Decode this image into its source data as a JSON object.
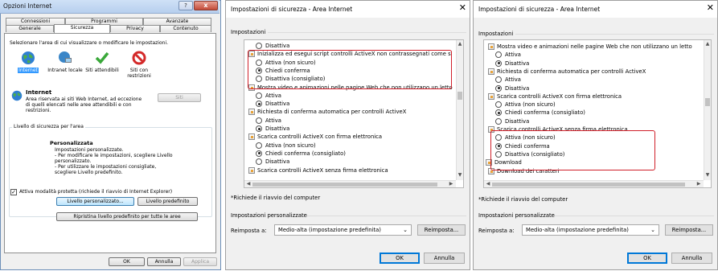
{
  "dialog1": {
    "title": "Opzioni Internet",
    "help_label": "?",
    "close_label": "x",
    "tabs_row1": [
      "Connessioni",
      "Programmi",
      "Avanzate"
    ],
    "tabs_row2": [
      "Generale",
      "Sicurezza",
      "Privacy",
      "Contenuto"
    ],
    "selected_tab": "Sicurezza",
    "select_zone_text": "Selezionare l'area di cui visualizzare o modificare le impostazioni.",
    "zones": [
      {
        "label": "Internet",
        "icon": "globe-icon",
        "selected": true
      },
      {
        "label": "Intranet locale",
        "icon": "intranet-icon",
        "selected": false
      },
      {
        "label": "Siti attendibili",
        "icon": "checkmark-icon",
        "selected": false
      },
      {
        "label": "Siti con restrizioni",
        "icon": "forbidden-icon",
        "selected": false
      }
    ],
    "zone_title": "Internet",
    "zone_desc": "Area riservata ai siti Web Internet, ad eccezione di quelli elencati nelle aree attendibili e con restrizioni.",
    "siti_button": "Siti",
    "level_group_label": "Livello di sicurezza per l'area",
    "custom_title": "Personalizzata",
    "custom_lines": [
      "Impostazioni personalizzate.",
      "- Per modificare le impostazioni, scegliere Livello personalizzato.",
      "- Per utilizzare le impostazioni consigliate, scegliere Livello predefinito."
    ],
    "protected_mode_label": "Attiva modalità protetta (richiede il riavvio di Internet Explorer)",
    "protected_mode_checked": true,
    "custom_level_button": "Livello personalizzato...",
    "default_level_button": "Livello predefinito",
    "reset_all_button": "Ripristina livello predefinito per tutte le aree",
    "ok_button": "OK",
    "cancel_button": "Annulla",
    "apply_button": "Applica"
  },
  "dialog2": {
    "title": "Impostazioni di sicurezza - Area Internet",
    "close_label": "✕",
    "settings_label": "Impostazioni",
    "items": [
      {
        "type": "radio",
        "label": "Disattiva",
        "checked": false
      },
      {
        "type": "setting",
        "label": "Inizializza ed esegui script controlli ActiveX non contrassegnati come si"
      },
      {
        "type": "radio",
        "label": "Attiva (non sicuro)",
        "checked": false
      },
      {
        "type": "radio",
        "label": "Chiedi conferma",
        "checked": true
      },
      {
        "type": "radio",
        "label": "Disattiva (consigliato)",
        "checked": false
      },
      {
        "type": "setting",
        "label": "Mostra video e animazioni nelle pagine Web che non utilizzano un letto"
      },
      {
        "type": "radio",
        "label": "Attiva",
        "checked": false
      },
      {
        "type": "radio",
        "label": "Disattiva",
        "checked": true
      },
      {
        "type": "setting",
        "label": "Richiesta di conferma automatica per controlli ActiveX"
      },
      {
        "type": "radio",
        "label": "Attiva",
        "checked": false
      },
      {
        "type": "radio",
        "label": "Disattiva",
        "checked": true
      },
      {
        "type": "setting",
        "label": "Scarica controlli ActiveX con firma elettronica"
      },
      {
        "type": "radio",
        "label": "Attiva (non sicuro)",
        "checked": false
      },
      {
        "type": "radio",
        "label": "Chiedi conferma (consigliato)",
        "checked": true
      },
      {
        "type": "radio",
        "label": "Disattiva",
        "checked": false
      },
      {
        "type": "setting",
        "label": "Scarica controlli ActiveX senza firma elettronica"
      }
    ],
    "restart_note": "*Richiede il riavvio del computer",
    "custom_settings_label": "Impostazioni personalizzate",
    "reset_to_label": "Reimposta a:",
    "reset_select_value": "Medio-alta (impostazione predefinita)",
    "reset_button": "Reimposta...",
    "ok_button": "OK",
    "cancel_button": "Annulla"
  },
  "dialog3": {
    "title": "Impostazioni di sicurezza - Area Internet",
    "close_label": "✕",
    "settings_label": "Impostazioni",
    "items": [
      {
        "type": "setting",
        "label": "Mostra video e animazioni nelle pagine Web che non utilizzano un letto"
      },
      {
        "type": "radio",
        "label": "Attiva",
        "checked": false
      },
      {
        "type": "radio",
        "label": "Disattiva",
        "checked": true
      },
      {
        "type": "setting",
        "label": "Richiesta di conferma automatica per controlli ActiveX"
      },
      {
        "type": "radio",
        "label": "Attiva",
        "checked": false
      },
      {
        "type": "radio",
        "label": "Disattiva",
        "checked": true
      },
      {
        "type": "setting",
        "label": "Scarica controlli ActiveX con firma elettronica"
      },
      {
        "type": "radio",
        "label": "Attiva (non sicuro)",
        "checked": false
      },
      {
        "type": "radio",
        "label": "Chiedi conferma (consigliato)",
        "checked": true
      },
      {
        "type": "radio",
        "label": "Disattiva",
        "checked": false
      },
      {
        "type": "setting",
        "label": "Scarica controlli ActiveX senza firma elettronica"
      },
      {
        "type": "radio",
        "label": "Attiva (non sicuro)",
        "checked": false
      },
      {
        "type": "radio",
        "label": "Chiedi conferma",
        "checked": true
      },
      {
        "type": "radio",
        "label": "Disattiva (consigliato)",
        "checked": false
      },
      {
        "type": "category",
        "label": "Download"
      },
      {
        "type": "setting",
        "label": "Download dei caratteri"
      }
    ],
    "restart_note": "*Richiede il riavvio del computer",
    "custom_settings_label": "Impostazioni personalizzate",
    "reset_to_label": "Reimposta a:",
    "reset_select_value": "Medio-alta (impostazione predefinita)",
    "reset_button": "Reimposta...",
    "ok_button": "OK",
    "cancel_button": "Annulla"
  },
  "colors": {
    "highlight": "#d0202a",
    "default_button": "#0078d7",
    "selection": "#3399ff"
  }
}
